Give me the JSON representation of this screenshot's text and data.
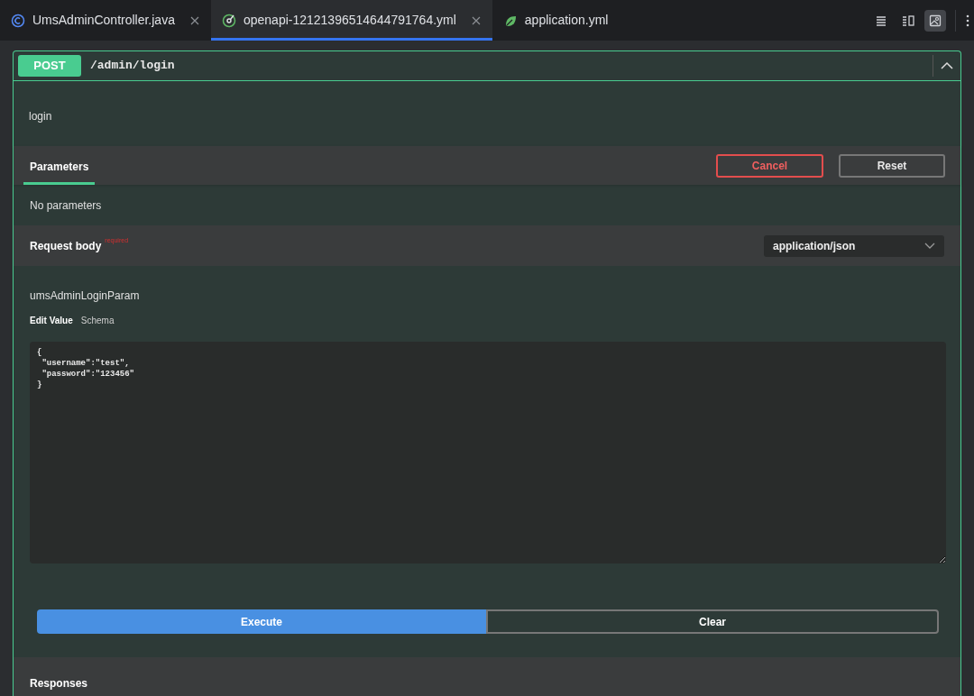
{
  "tabs": [
    {
      "label": "UmsAdminController.java",
      "kind": "class",
      "selected": false,
      "closable": true
    },
    {
      "label": "openapi-12121396514644791764.yml",
      "kind": "openapi",
      "selected": true,
      "closable": true
    },
    {
      "label": "application.yml",
      "kind": "leaf",
      "selected": false,
      "closable": false
    }
  ],
  "toolbar": [
    {
      "kind": "lines",
      "selected": false
    },
    {
      "kind": "split",
      "selected": false
    },
    {
      "kind": "preview",
      "selected": true
    }
  ],
  "operation": {
    "method": "POST",
    "path": "/admin/login",
    "expanded": true,
    "description": "login",
    "parameters": {
      "tab": "Parameters",
      "cancel": "Cancel",
      "reset": "Reset",
      "empty": "No parameters"
    },
    "request_body": {
      "title": "Request body",
      "required": "required",
      "content_type": "application/json",
      "model": "umsAdminLoginParam",
      "view_tabs": [
        {
          "label": "Edit Value",
          "selected": true
        },
        {
          "label": "Schema",
          "selected": false
        }
      ],
      "value": "{\n \"username\":\"test\",\n \"password\":\"123456\"\n}"
    },
    "execute": "Execute",
    "clear": "Clear",
    "responses": "Responses"
  }
}
